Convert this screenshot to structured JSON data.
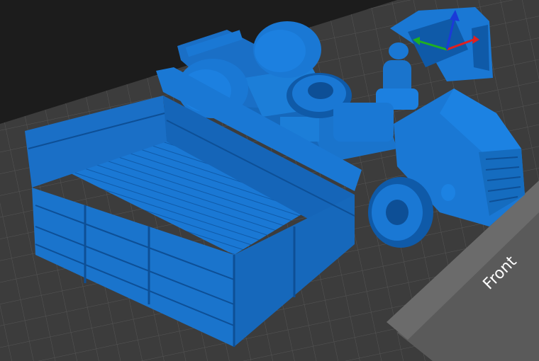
{
  "viewport": {
    "background": "#1c1c1c",
    "plate_color": "#404040",
    "grid_color": "#555555",
    "model_color": "#1a78d4",
    "model_shadow": "#0d4f96",
    "front_label": "Front"
  },
  "gizmo": {
    "axes": [
      {
        "name": "x-axis",
        "color": "#e02020"
      },
      {
        "name": "y-axis",
        "color": "#20b020"
      },
      {
        "name": "z-axis",
        "color": "#1a3ad8"
      }
    ]
  },
  "objects": [
    {
      "name": "truck-cargo-bed"
    },
    {
      "name": "truck-chassis"
    },
    {
      "name": "truck-cab"
    },
    {
      "name": "truck-hood-front"
    },
    {
      "name": "driver-figure"
    },
    {
      "name": "spare-wheel"
    },
    {
      "name": "rear-wheels"
    },
    {
      "name": "front-wheel"
    }
  ]
}
